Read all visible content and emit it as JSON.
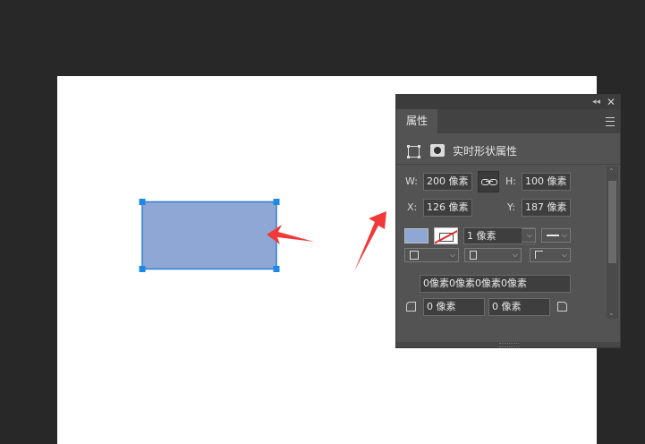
{
  "panel": {
    "tab_label": "属性",
    "section_title": "实时形状属性",
    "width_label": "W:",
    "width_value": "200 像素",
    "height_label": "H:",
    "height_value": "100 像素",
    "x_label": "X:",
    "x_value": "126 像素",
    "y_label": "Y:",
    "y_value": "187 像素",
    "stroke_width": "1 像素",
    "corner_radii": "0像素0像素0像素0像素",
    "corner_tl": "0 像素",
    "corner_tr": "0 像素",
    "icons": {
      "collapse": "double-left-arrow-icon",
      "close": "close-icon",
      "menu": "hamburger-menu-icon",
      "shape_bounds": "shape-bounds-icon",
      "mask": "mask-icon",
      "link": "chain-link-icon"
    }
  },
  "colors": {
    "fill": "#8fa7d5",
    "selection": "#1e88e5",
    "annotation_arrow": "#f03a3a"
  }
}
